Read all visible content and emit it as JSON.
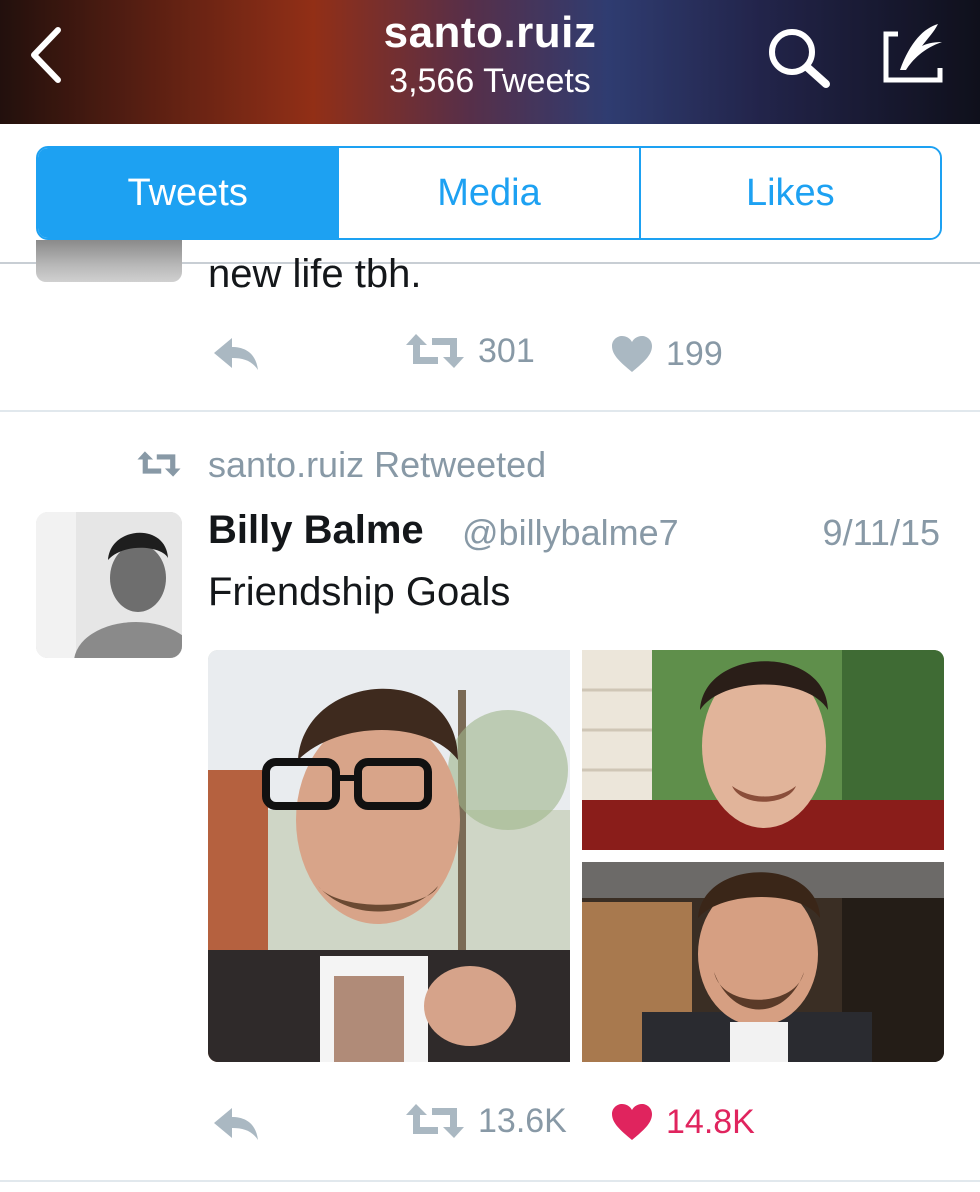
{
  "header": {
    "title": "santo.ruiz",
    "subtitle": "3,566 Tweets"
  },
  "tabs": [
    {
      "label": "Tweets",
      "active": true
    },
    {
      "label": "Media",
      "active": false
    },
    {
      "label": "Likes",
      "active": false
    }
  ],
  "previous_tweet": {
    "text": "new life tbh.",
    "retweets": "301",
    "likes": "199"
  },
  "tweet": {
    "retweet_context": "santo.ruiz Retweeted",
    "name": "Billy Balme",
    "handle": "@billybalme7",
    "date": "9/11/15",
    "text": "Friendship Goals",
    "retweets": "13.6K",
    "likes": "14.8K",
    "liked": true
  },
  "colors": {
    "accent": "#1da1f2",
    "muted": "#8899a6",
    "like": "#e0245e",
    "text": "#14171a"
  },
  "icons": [
    "back-arrow-icon",
    "search-icon",
    "compose-icon",
    "reply-icon",
    "retweet-icon",
    "heart-icon"
  ]
}
